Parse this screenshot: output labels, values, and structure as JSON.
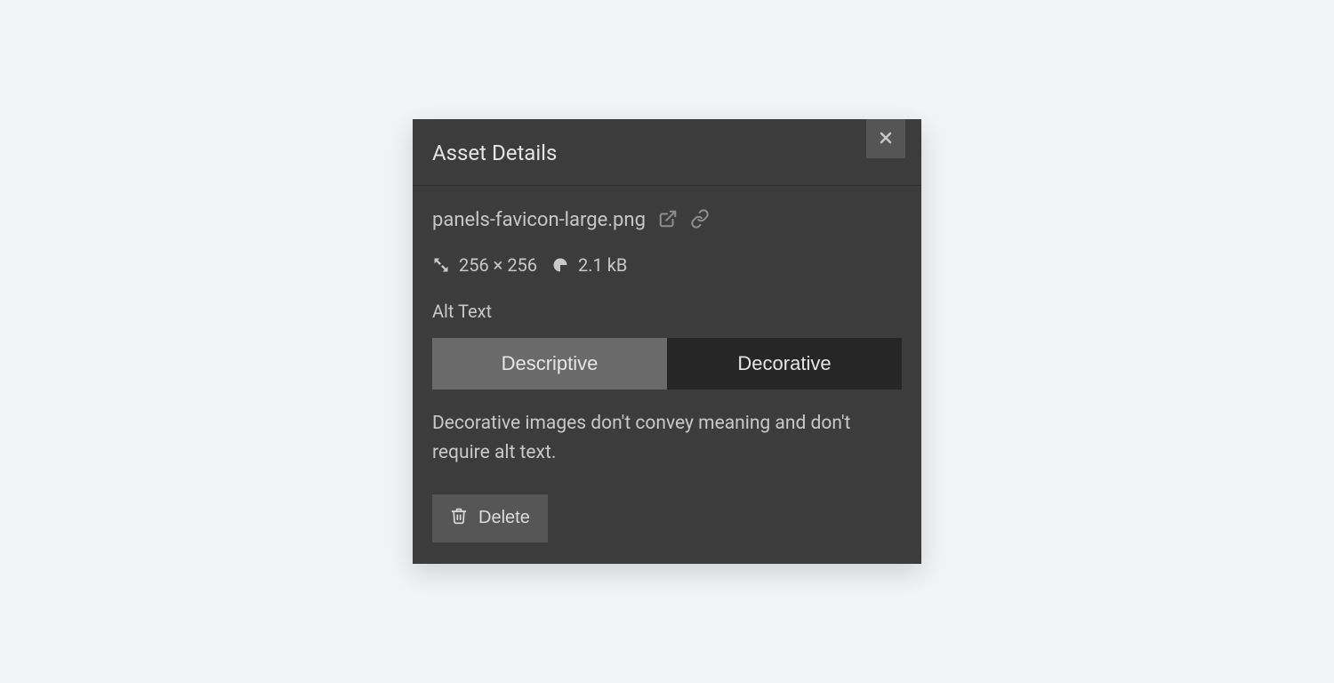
{
  "panel": {
    "title": "Asset Details",
    "close_icon": "close-icon"
  },
  "file": {
    "name": "panels-favicon-large.png",
    "open_icon": "external-link-icon",
    "link_icon": "link-icon",
    "dimensions_icon": "dimensions-icon",
    "dimensions": "256 × 256",
    "size_icon": "disk-icon",
    "size": "2.1 kB"
  },
  "alt_text": {
    "label": "Alt Text",
    "options": {
      "descriptive": "Descriptive",
      "decorative": "Decorative"
    },
    "selected": "descriptive",
    "help": "Decorative images don't convey meaning and don't require alt text."
  },
  "actions": {
    "delete_label": "Delete",
    "delete_icon": "trash-icon"
  }
}
